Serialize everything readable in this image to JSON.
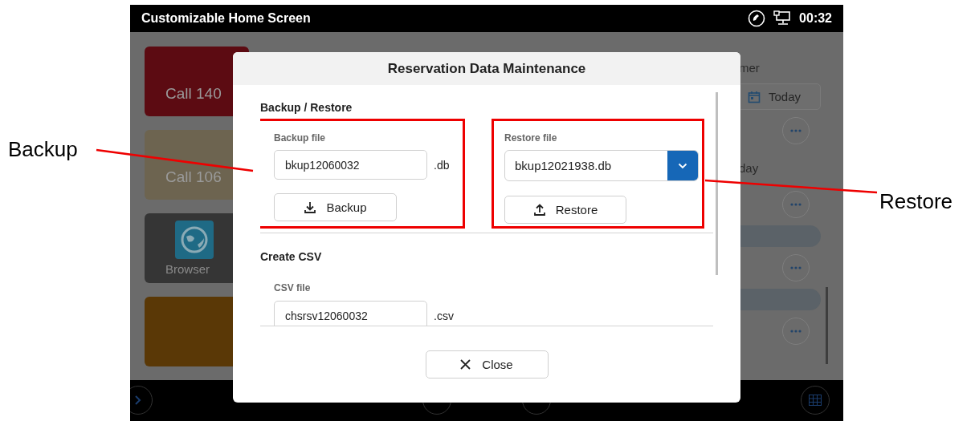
{
  "status_bar": {
    "title": "Customizable Home Screen",
    "time": "00:32"
  },
  "home_tiles": [
    {
      "kind": "text",
      "label": "Call 140",
      "color": "#5c0b12"
    },
    {
      "kind": "text",
      "label": "Call 106",
      "color": "#6d6450"
    },
    {
      "kind": "app",
      "label": "Browser",
      "color": "#353535"
    },
    {
      "kind": "blank",
      "color": "#5a3806"
    }
  ],
  "right_list": [
    {
      "kind": "text",
      "label": "mer"
    },
    {
      "kind": "date_button",
      "label": "Today"
    },
    {
      "kind": "more"
    },
    {
      "kind": "text",
      "label": "day"
    },
    {
      "kind": "more"
    },
    {
      "kind": "pill"
    },
    {
      "kind": "more"
    },
    {
      "kind": "pill"
    },
    {
      "kind": "more"
    }
  ],
  "dialog": {
    "title": "Reservation Data Maintenance",
    "backup_restore": {
      "heading": "Backup / Restore",
      "backup": {
        "label": "Backup file",
        "value": "bkup12060032",
        "suffix": ".db",
        "button": "Backup"
      },
      "restore": {
        "label": "Restore file",
        "value": "bkup12021938.db",
        "button": "Restore"
      }
    },
    "create_csv": {
      "heading": "Create CSV",
      "label": "CSV file",
      "value": "chsrsv12060032",
      "suffix": ".csv"
    },
    "close_button": "Close"
  },
  "annotations": [
    {
      "kind": "callout_left",
      "label": "Backup"
    },
    {
      "kind": "callout_right",
      "label": "Restore"
    }
  ]
}
